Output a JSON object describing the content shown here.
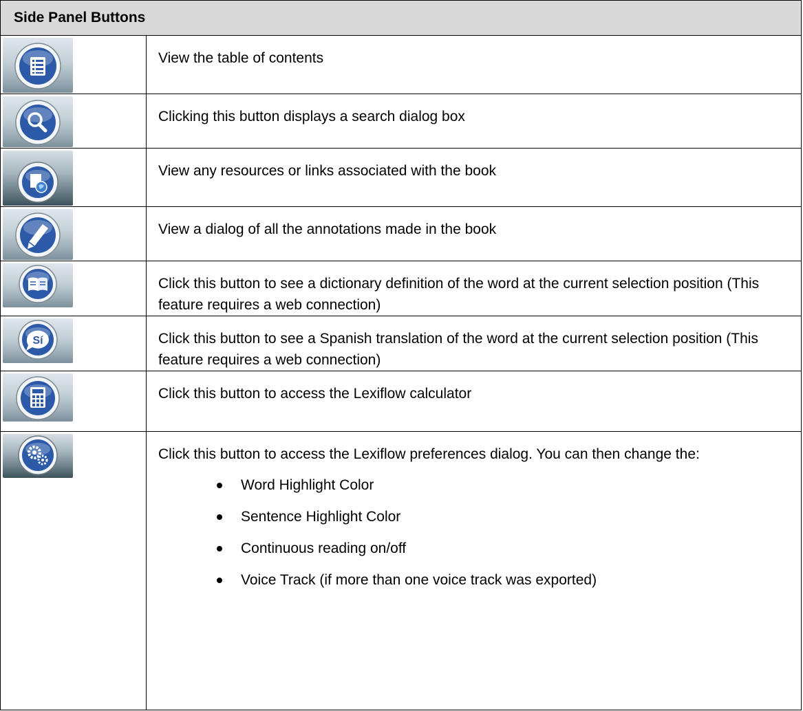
{
  "table": {
    "title": "Side Panel Buttons",
    "rows": [
      {
        "icon": "table-of-contents-icon",
        "text": "View the table of contents"
      },
      {
        "icon": "search-icon",
        "text": "Clicking this button displays a search dialog box"
      },
      {
        "icon": "resources-globe-icon",
        "text": "View any resources or links associated with the book"
      },
      {
        "icon": "annotations-pencil-icon",
        "text": "View a dialog of all the annotations made in the book"
      },
      {
        "icon": "dictionary-book-icon",
        "text": "Click this button to see a dictionary definition of the word at the current selection position (This feature requires a web connection)"
      },
      {
        "icon": "spanish-translation-icon",
        "icon_text": "Sí",
        "text": "Click this button to see a Spanish translation of the word at the current selection position (This feature requires a web connection)"
      },
      {
        "icon": "calculator-icon",
        "text": "Click this button to access the Lexiflow calculator"
      },
      {
        "icon": "preferences-gears-icon",
        "text": "Click this button to access the Lexiflow preferences dialog. You can then change the:",
        "bullets": [
          "Word Highlight Color",
          "Sentence Highlight Color",
          "Continuous reading on/off",
          "Voice Track (if more than one voice track was exported)"
        ]
      }
    ]
  },
  "colors": {
    "header_bg": "#d9d9d9",
    "icon_blue": "#2d5aa8",
    "icon_ring": "#e8eef2",
    "border": "#000000"
  }
}
